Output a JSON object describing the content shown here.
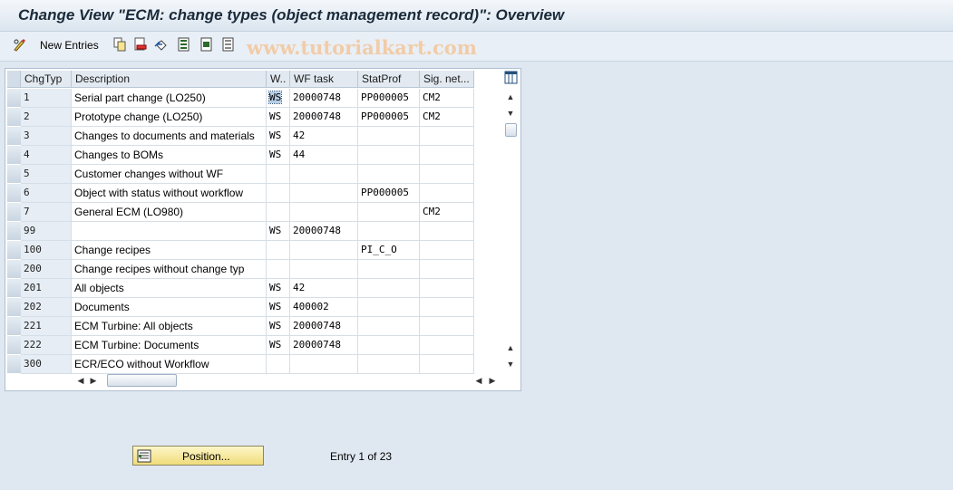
{
  "window": {
    "title": "Change View \"ECM: change types (object management record)\": Overview"
  },
  "toolbar": {
    "new_entries_label": "New Entries",
    "icons": [
      "glasses-pencil-icon",
      "copy-icon",
      "delete-icon",
      "undo-icon",
      "select-all-icon",
      "select-block-icon",
      "deselect-all-icon"
    ]
  },
  "watermark": "www.tutorialkart.com",
  "table": {
    "columns": [
      "ChgTyp",
      "Description",
      "W..",
      "WF task",
      "StatProf",
      "Sig. net..."
    ],
    "rows": [
      {
        "chgtyp": "1",
        "desc": "Serial part change (LO250)",
        "w": "WS",
        "wf": "20000748",
        "stat": "PP000005",
        "sig": "CM2"
      },
      {
        "chgtyp": "2",
        "desc": "Prototype change (LO250)",
        "w": "WS",
        "wf": "20000748",
        "stat": "PP000005",
        "sig": "CM2"
      },
      {
        "chgtyp": "3",
        "desc": "Changes to documents and materials",
        "w": "WS",
        "wf": "42",
        "stat": "",
        "sig": ""
      },
      {
        "chgtyp": "4",
        "desc": "Changes to BOMs",
        "w": "WS",
        "wf": "44",
        "stat": "",
        "sig": ""
      },
      {
        "chgtyp": "5",
        "desc": "Customer  changes without WF",
        "w": "",
        "wf": "",
        "stat": "",
        "sig": ""
      },
      {
        "chgtyp": "6",
        "desc": "Object with status without workflow",
        "w": "",
        "wf": "",
        "stat": "PP000005",
        "sig": ""
      },
      {
        "chgtyp": "7",
        "desc": "General ECM (LO980)",
        "w": "",
        "wf": "",
        "stat": "",
        "sig": "CM2"
      },
      {
        "chgtyp": "99",
        "desc": "",
        "w": "WS",
        "wf": "20000748",
        "stat": "",
        "sig": ""
      },
      {
        "chgtyp": "100",
        "desc": "Change recipes",
        "w": "",
        "wf": "",
        "stat": "PI_C_O",
        "sig": ""
      },
      {
        "chgtyp": "200",
        "desc": "Change recipes without change typ",
        "w": "",
        "wf": "",
        "stat": "",
        "sig": ""
      },
      {
        "chgtyp": "201",
        "desc": "All objects",
        "w": "WS",
        "wf": "42",
        "stat": "",
        "sig": ""
      },
      {
        "chgtyp": "202",
        "desc": "Documents",
        "w": "WS",
        "wf": "400002",
        "stat": "",
        "sig": ""
      },
      {
        "chgtyp": "221",
        "desc": "ECM Turbine: All objects",
        "w": "WS",
        "wf": "20000748",
        "stat": "",
        "sig": ""
      },
      {
        "chgtyp": "222",
        "desc": "ECM Turbine: Documents",
        "w": "WS",
        "wf": "20000748",
        "stat": "",
        "sig": ""
      },
      {
        "chgtyp": "300",
        "desc": "ECR/ECO without Workflow",
        "w": "",
        "wf": "",
        "stat": "",
        "sig": ""
      }
    ]
  },
  "footer": {
    "position_label": "Position...",
    "entry_text": "Entry 1 of 23"
  }
}
